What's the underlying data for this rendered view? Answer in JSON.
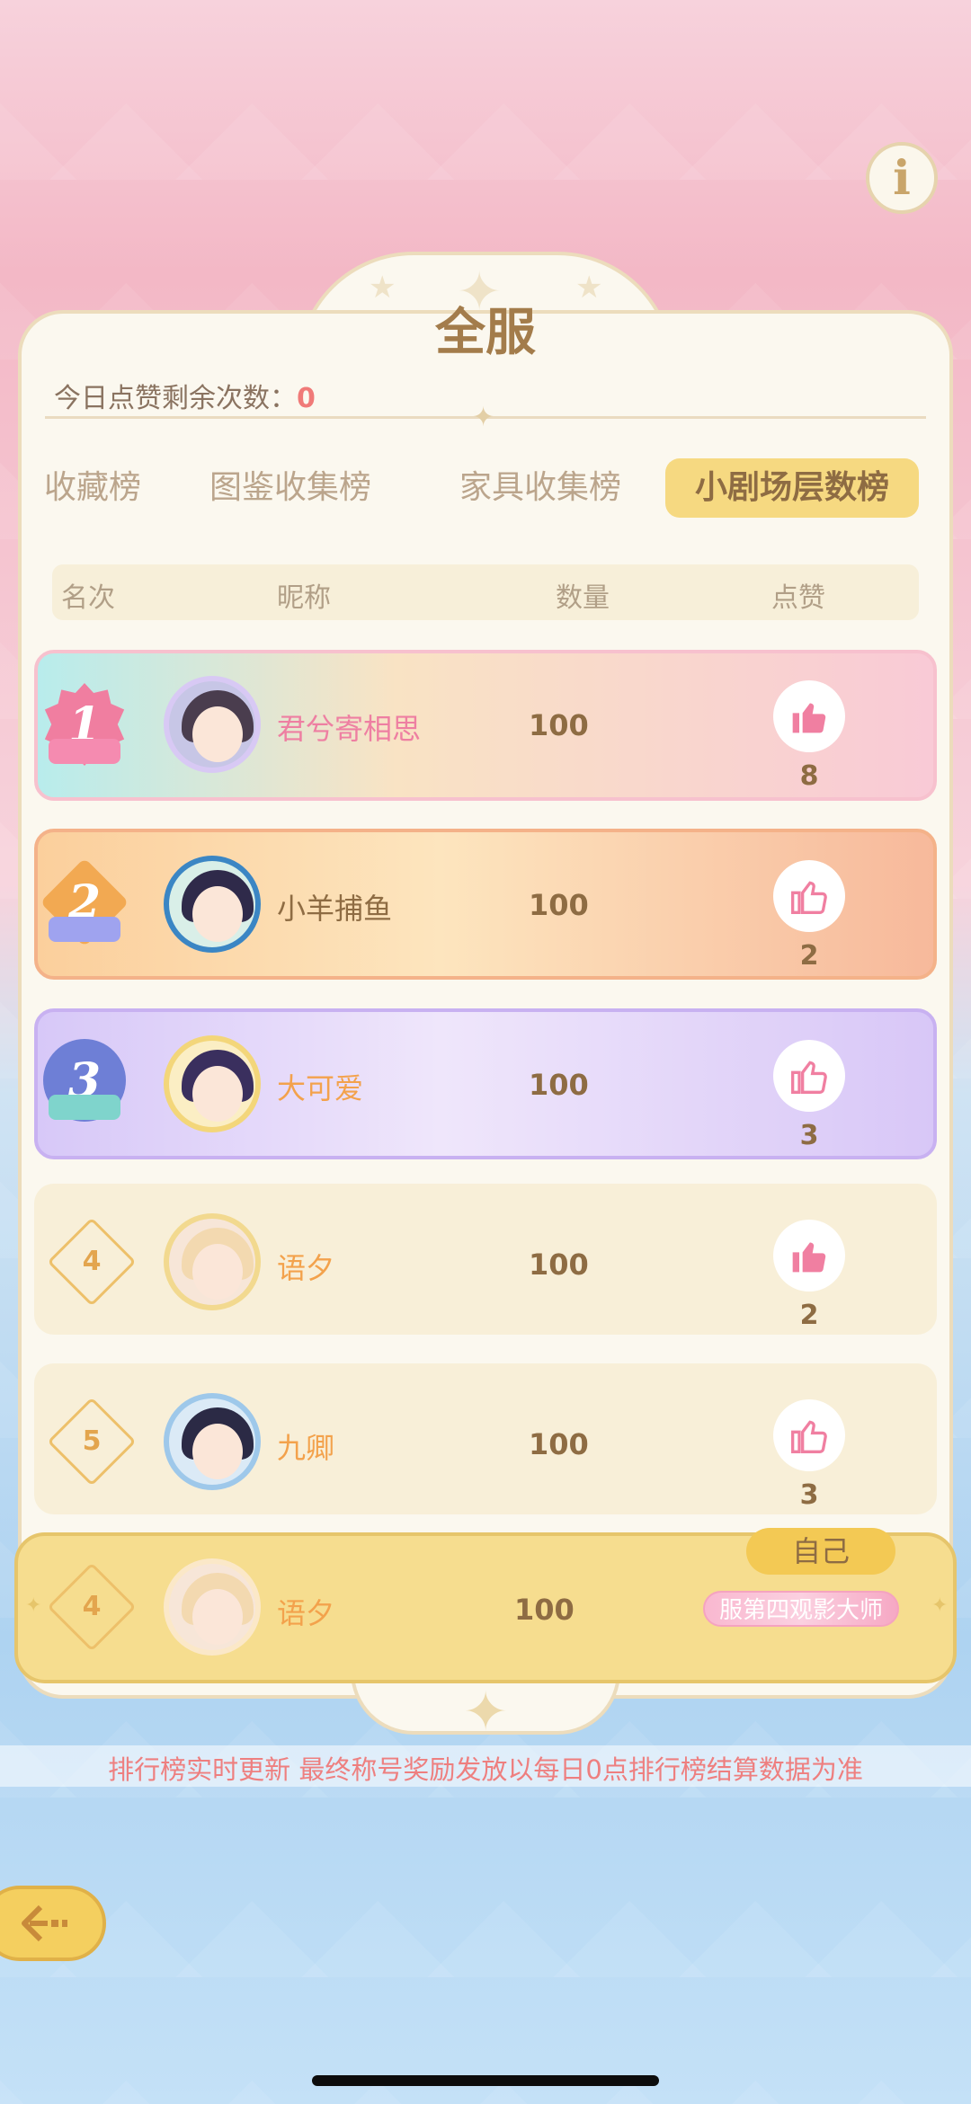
{
  "colors": {
    "accent_gold": "#f6d981",
    "title_brown": "#a37c4b",
    "note_red": "#ee7f7f",
    "likes_red": "#f07a78"
  },
  "info_button": {
    "icon": "info-icon",
    "glyph": "i"
  },
  "header": {
    "title": "全服",
    "likes_label": "今日点赞剩余次数：",
    "likes_remaining": "0"
  },
  "tabs": [
    {
      "label": "收藏榜",
      "active": false
    },
    {
      "label": "图鉴收集榜",
      "active": false
    },
    {
      "label": "家具收集榜",
      "active": false
    },
    {
      "label": "小剧场层数榜",
      "active": true
    }
  ],
  "columns": {
    "rank": "名次",
    "nickname": "昵称",
    "count": "数量",
    "like": "点赞"
  },
  "rows": [
    {
      "rank": "1",
      "nickname": "君兮寄相思",
      "count": "100",
      "likes": "8",
      "liked": true
    },
    {
      "rank": "2",
      "nickname": "小羊捕鱼",
      "count": "100",
      "likes": "2",
      "liked": false
    },
    {
      "rank": "3",
      "nickname": "大可爱",
      "count": "100",
      "likes": "3",
      "liked": false
    },
    {
      "rank": "4",
      "nickname": "语夕",
      "count": "100",
      "likes": "2",
      "liked": true
    },
    {
      "rank": "5",
      "nickname": "九卿",
      "count": "100",
      "likes": "3",
      "liked": false
    }
  ],
  "self_row": {
    "rank": "4",
    "nickname": "语夕",
    "count": "100",
    "tag": "自己",
    "title": "服第四观影大师"
  },
  "footer_note": "排行榜实时更新 最终称号奖励发放以每日0点排行榜结算数据为准",
  "back_button": {
    "icon": "back-arrow-icon"
  }
}
